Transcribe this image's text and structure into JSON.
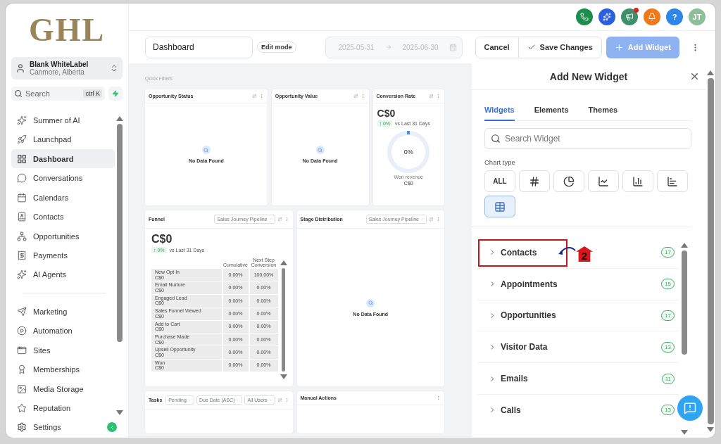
{
  "logo": "GHL",
  "account": {
    "name": "Blank WhiteLabel",
    "location": "Canmore, Alberta"
  },
  "sidebar_search": {
    "placeholder": "Search",
    "shortcut": "ctrl K"
  },
  "nav_groups": [
    {
      "items": [
        {
          "label": "Summer of AI",
          "selected": false
        },
        {
          "label": "Launchpad",
          "selected": false
        },
        {
          "label": "Dashboard",
          "selected": true
        },
        {
          "label": "Conversations",
          "selected": false
        },
        {
          "label": "Calendars",
          "selected": false
        },
        {
          "label": "Contacts",
          "selected": false
        },
        {
          "label": "Opportunities",
          "selected": false
        },
        {
          "label": "Payments",
          "selected": false
        },
        {
          "label": "AI Agents",
          "selected": false
        }
      ]
    },
    {
      "items": [
        {
          "label": "Marketing",
          "selected": false
        },
        {
          "label": "Automation",
          "selected": false
        },
        {
          "label": "Sites",
          "selected": false
        },
        {
          "label": "Memberships",
          "selected": false
        },
        {
          "label": "Media Storage",
          "selected": false
        },
        {
          "label": "Reputation",
          "selected": false
        }
      ]
    }
  ],
  "settings": {
    "label": "Settings"
  },
  "header_actions": [
    {
      "kind": "phone",
      "color": "#1e8e4e",
      "badge": false
    },
    {
      "kind": "sparkle",
      "color": "#2b5fe0",
      "badge": false
    },
    {
      "kind": "megaphone",
      "color": "#3f8f6a",
      "badge": true
    },
    {
      "kind": "bell",
      "color": "#f07a1a",
      "badge": false
    },
    {
      "kind": "help",
      "color": "#2e86e8",
      "badge": false,
      "label": "?"
    },
    {
      "kind": "avatar",
      "color": "#8cbf9a",
      "badge": false,
      "label": "JT"
    }
  ],
  "toolbar": {
    "dashboard_name": "Dashboard",
    "mode": "Edit mode",
    "date_from": "2025-05-31",
    "date_to": "2025-06-30",
    "cancel": "Cancel",
    "save": "Save Changes",
    "add": "Add Widget"
  },
  "quick_filters": "Quick Filters",
  "widget_rows": [
    [
      {
        "kind": "empty",
        "title": "Opportunity Status",
        "message": "No Data Found"
      },
      {
        "kind": "empty",
        "title": "Opportunity Value",
        "message": "No Data Found"
      },
      {
        "kind": "conversion",
        "title": "Conversion Rate",
        "amount": "C$0",
        "change": "↑ 0%",
        "compare": "vs Last 31 Days",
        "percent": "0%",
        "caption": "Won revenue",
        "caption_value": "C$0"
      }
    ],
    [
      {
        "kind": "funnel",
        "title": "Funnel",
        "filters": [
          "Sales Journey Pipeline"
        ],
        "amount": "C$0",
        "change": "↑ 0%",
        "compare": "vs Last 31 Days",
        "columns": [
          "Cumulative",
          "Next Step Conversion"
        ],
        "rows": [
          {
            "stage": "New Opt In",
            "value": "C$0",
            "cumulative": "0.00%",
            "next": "100.00%"
          },
          {
            "stage": "Email Nurture",
            "value": "C$0",
            "cumulative": "0.00%",
            "next": "0.00%"
          },
          {
            "stage": "Engaged Lead",
            "value": "C$0",
            "cumulative": "0.00%",
            "next": "0.00%"
          },
          {
            "stage": "Sales Funnel Viewed",
            "value": "C$0",
            "cumulative": "0.00%",
            "next": "0.00%"
          },
          {
            "stage": "Add to Cart",
            "value": "C$0",
            "cumulative": "0.00%",
            "next": "0.00%"
          },
          {
            "stage": "Purchase Made",
            "value": "C$0",
            "cumulative": "0.00%",
            "next": "0.00%"
          },
          {
            "stage": "Upsell Opportunity",
            "value": "C$0",
            "cumulative": "0.00%",
            "next": "0.00%"
          },
          {
            "stage": "Won",
            "value": "C$0",
            "cumulative": "0.00%",
            "next": "0.00%"
          }
        ]
      },
      {
        "kind": "empty",
        "title": "Stage Distribution",
        "filters": [
          "Sales Journey Pipeline"
        ],
        "message": "No Data Found"
      }
    ],
    [
      {
        "kind": "blank",
        "title": "Tasks",
        "filters": [
          "Pending",
          "Due Date (ASC)",
          "All Users"
        ]
      },
      {
        "kind": "blank",
        "title": "Manual Actions"
      }
    ]
  ],
  "panel": {
    "title": "Add New Widget",
    "tabs": [
      {
        "label": "Widgets",
        "selected": true
      },
      {
        "label": "Elements",
        "selected": false
      },
      {
        "label": "Themes",
        "selected": false
      }
    ],
    "search": {
      "placeholder": "Search Widget"
    },
    "chart_type_label": "Chart type",
    "chart_types": [
      {
        "kind": "all",
        "label": "ALL",
        "selected": false
      },
      {
        "kind": "number",
        "selected": false
      },
      {
        "kind": "pie",
        "selected": false
      },
      {
        "kind": "line",
        "selected": false
      },
      {
        "kind": "bar",
        "selected": false
      },
      {
        "kind": "hbar",
        "selected": false
      },
      {
        "kind": "table",
        "selected": true
      }
    ],
    "categories": [
      {
        "label": "Contacts",
        "count": "17",
        "expanded": false
      },
      {
        "label": "Appointments",
        "count": "15",
        "expanded": false
      },
      {
        "label": "Opportunities",
        "count": "17",
        "expanded": false
      },
      {
        "label": "Visitor Data",
        "count": "13",
        "expanded": false
      },
      {
        "label": "Emails",
        "count": "11",
        "expanded": false
      },
      {
        "label": "Calls",
        "count": "13",
        "expanded": false
      }
    ]
  },
  "annotation": {
    "label": "2"
  }
}
